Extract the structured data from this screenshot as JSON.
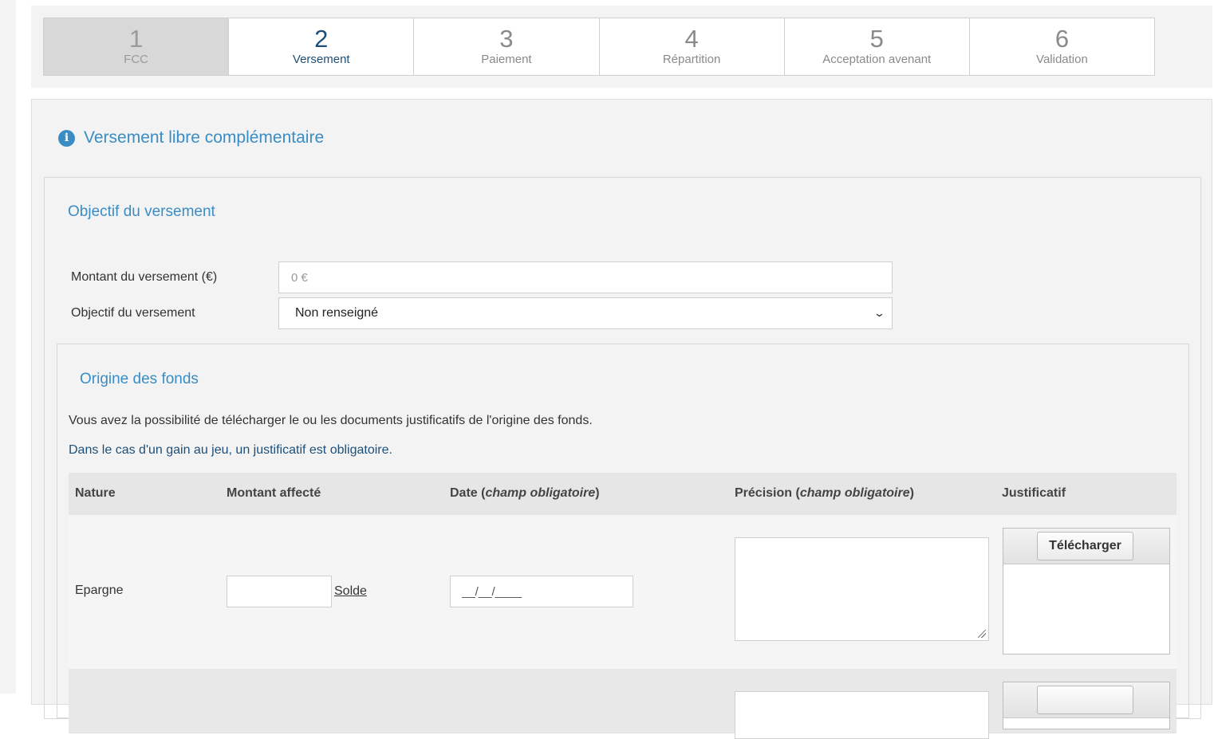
{
  "stepper": {
    "steps": [
      {
        "num": "1",
        "label": "FCC",
        "state": "done"
      },
      {
        "num": "2",
        "label": "Versement",
        "state": "active"
      },
      {
        "num": "3",
        "label": "Paiement",
        "state": "pending"
      },
      {
        "num": "4",
        "label": "Répartition",
        "state": "pending"
      },
      {
        "num": "5",
        "label": "Acceptation avenant",
        "state": "pending"
      },
      {
        "num": "6",
        "label": "Validation",
        "state": "pending"
      }
    ]
  },
  "panel": {
    "title": "Versement libre complémentaire",
    "icon": "info-icon"
  },
  "objectif": {
    "section_title": "Objectif du versement",
    "amount_label": "Montant du versement (€)",
    "amount_placeholder": "0 €",
    "amount_value": "",
    "goal_label": "Objectif du versement",
    "goal_selected": "Non renseigné"
  },
  "origine": {
    "section_title": "Origine des fonds",
    "help_text": "Vous avez la possibilité de télécharger le ou les documents justificatifs de l'origine des fonds.",
    "warning_text": "Dans le cas d'un gain au jeu, un justificatif est obligatoire.",
    "table": {
      "headers": {
        "nature": "Nature",
        "amount": "Montant affecté",
        "date": "Date (",
        "date_em": "champ obligatoire",
        "date_end": ")",
        "precision": "Précision (",
        "precision_em": "champ obligatoire",
        "precision_end": ")",
        "proof": "Justificatif"
      },
      "rows": [
        {
          "nature": "Epargne",
          "amount_value": "",
          "balance_link": "Solde",
          "date_placeholder": "__/__/____",
          "precision_value": "",
          "upload_label": "Télécharger"
        }
      ]
    }
  },
  "colors": {
    "accent_blue": "#3a8dc4",
    "dark_blue": "#1d4f7a",
    "panel_bg": "#f3f3f3"
  }
}
